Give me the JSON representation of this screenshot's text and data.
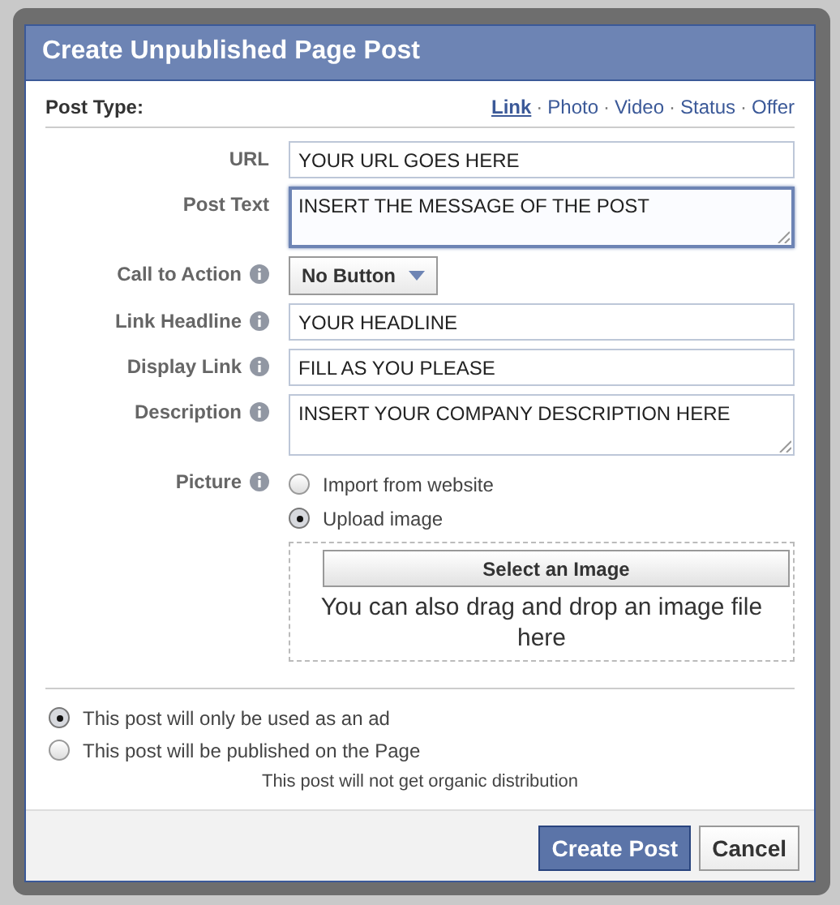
{
  "dialog": {
    "title": "Create Unpublished Page Post"
  },
  "post_type": {
    "label": "Post Type:",
    "separator": "·",
    "options": [
      {
        "label": "Link",
        "selected": true
      },
      {
        "label": "Photo",
        "selected": false
      },
      {
        "label": "Video",
        "selected": false
      },
      {
        "label": "Status",
        "selected": false
      },
      {
        "label": "Offer",
        "selected": false
      }
    ]
  },
  "fields": [
    {
      "label": "URL",
      "info": false,
      "kind": "text",
      "value": "YOUR URL GOES HERE",
      "focused": false
    },
    {
      "label": "Post Text",
      "info": false,
      "kind": "textarea",
      "value": "INSERT THE MESSAGE OF THE POST",
      "focused": true
    },
    {
      "label": "Call to Action",
      "info": true,
      "kind": "select",
      "value": "No Button",
      "focused": false
    },
    {
      "label": "Link Headline",
      "info": true,
      "kind": "text",
      "value": "YOUR HEADLINE",
      "focused": false
    },
    {
      "label": "Display Link",
      "info": true,
      "kind": "text",
      "value": "FILL AS YOU PLEASE",
      "focused": false
    },
    {
      "label": "Description",
      "info": true,
      "kind": "textarea",
      "value": "INSERT YOUR COMPANY DESCRIPTION HERE",
      "focused": false
    }
  ],
  "picture": {
    "label": "Picture",
    "info": true,
    "options": [
      {
        "label": "Import from website",
        "selected": false
      },
      {
        "label": "Upload image",
        "selected": true
      }
    ],
    "select_button": "Select an Image",
    "drop_hint": "You can also drag and drop an image file here"
  },
  "distribution": {
    "options": [
      {
        "label": "This post will only be used as an ad",
        "selected": true
      },
      {
        "label": "This post will be published on the Page",
        "selected": false
      }
    ],
    "note": "This post will not get organic distribution"
  },
  "buttons": [
    {
      "label": "Create Post",
      "kind": "primary"
    },
    {
      "label": "Cancel",
      "kind": "default"
    }
  ]
}
